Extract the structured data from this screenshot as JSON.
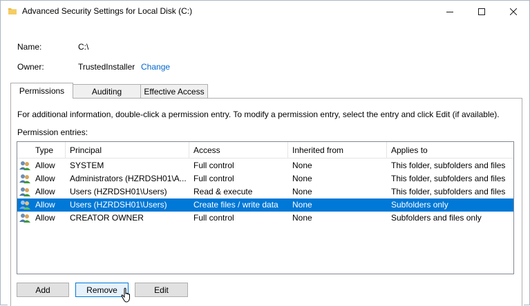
{
  "window": {
    "title": "Advanced Security Settings for Local Disk (C:)",
    "folder_icon": "folder-icon",
    "controls": {
      "minimize": "–",
      "maximize": "☐",
      "close": "✕"
    }
  },
  "details": {
    "name_label": "Name:",
    "name_value": "C:\\",
    "owner_label": "Owner:",
    "owner_value": "TrustedInstaller",
    "change_link": "Change"
  },
  "tabs": [
    {
      "label": "Permissions",
      "active": true
    },
    {
      "label": "Auditing",
      "active": false
    },
    {
      "label": "Effective Access",
      "active": false
    }
  ],
  "permissions": {
    "info": "For additional information, double-click a permission entry. To modify a permission entry, select the entry and click Edit (if available).",
    "entries_label": "Permission entries:",
    "columns": [
      "Type",
      "Principal",
      "Access",
      "Inherited from",
      "Applies to"
    ],
    "rows": [
      [
        "Allow",
        "SYSTEM",
        "Full control",
        "None",
        "This folder, subfolders and files"
      ],
      [
        "Allow",
        "Administrators (HZRDSH01\\A...",
        "Full control",
        "None",
        "This folder, subfolders and files"
      ],
      [
        "Allow",
        "Users (HZRDSH01\\Users)",
        "Read & execute",
        "None",
        "This folder, subfolders and files"
      ],
      [
        "Allow",
        "Users (HZRDSH01\\Users)",
        "Create files / write data",
        "None",
        "Subfolders only"
      ],
      [
        "Allow",
        "CREATOR OWNER",
        "Full control",
        "None",
        "Subfolders and files only"
      ]
    ],
    "selected_row": 3,
    "row_icon": "users-icon"
  },
  "buttons": {
    "add": "Add",
    "remove": "Remove",
    "edit": "Edit"
  },
  "colors": {
    "selection": "#0078d7",
    "link": "#0066cc"
  }
}
